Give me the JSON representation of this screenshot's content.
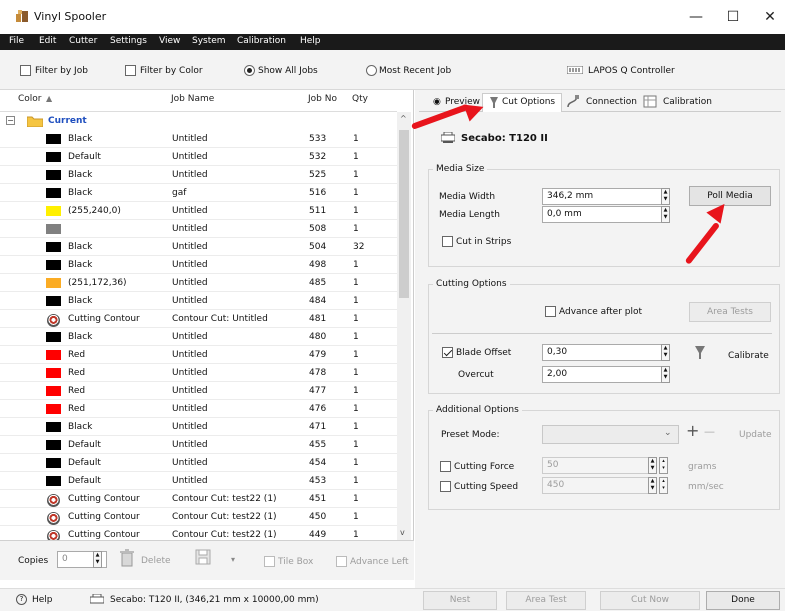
{
  "window": {
    "title": "Vinyl Spooler",
    "minimize": "—",
    "maximize": "☐",
    "close": "✕"
  },
  "menu": [
    "File",
    "Edit",
    "Cutter",
    "Settings",
    "View",
    "System",
    "Calibration",
    "Help"
  ],
  "toolbar": {
    "filter_by_job": "Filter by Job",
    "filter_by_color": "Filter by Color",
    "show_all_jobs": "Show All Jobs",
    "most_recent_job": "Most Recent Job",
    "controller": "LAPOS Q Controller"
  },
  "table": {
    "headers": {
      "color": "Color",
      "job_name": "Job Name",
      "job_no": "Job No",
      "qty": "Qty"
    },
    "group": "Current",
    "rows": [
      {
        "color": "Black",
        "swatch": "#000000",
        "job": "Untitled",
        "no": "533",
        "qty": "1"
      },
      {
        "color": "Default",
        "swatch": "#000000",
        "job": "Untitled",
        "no": "532",
        "qty": "1"
      },
      {
        "color": "Black",
        "swatch": "#000000",
        "job": "Untitled",
        "no": "525",
        "qty": "1"
      },
      {
        "color": "Black",
        "swatch": "#000000",
        "job": "gaf",
        "no": "516",
        "qty": "1"
      },
      {
        "color": "(255,240,0)",
        "swatch": "#fff000",
        "job": "Untitled",
        "no": "511",
        "qty": "1"
      },
      {
        "color": "",
        "swatch": "#808080",
        "job": "Untitled",
        "no": "508",
        "qty": "1"
      },
      {
        "color": "Black",
        "swatch": "#000000",
        "job": "Untitled",
        "no": "504",
        "qty": "32"
      },
      {
        "color": "Black",
        "swatch": "#000000",
        "job": "Untitled",
        "no": "498",
        "qty": "1"
      },
      {
        "color": "(251,172,36)",
        "swatch": "#fbac24",
        "job": "Untitled",
        "no": "485",
        "qty": "1"
      },
      {
        "color": "Black",
        "swatch": "#000000",
        "job": "Untitled",
        "no": "484",
        "qty": "1"
      },
      {
        "color": "Cutting Contour",
        "swatch": "contour",
        "job": "Contour Cut: Untitled",
        "no": "481",
        "qty": "1"
      },
      {
        "color": "Black",
        "swatch": "#000000",
        "job": "Untitled",
        "no": "480",
        "qty": "1"
      },
      {
        "color": "Red",
        "swatch": "#ff0000",
        "job": "Untitled",
        "no": "479",
        "qty": "1"
      },
      {
        "color": "Red",
        "swatch": "#ff0000",
        "job": "Untitled",
        "no": "478",
        "qty": "1"
      },
      {
        "color": "Red",
        "swatch": "#ff0000",
        "job": "Untitled",
        "no": "477",
        "qty": "1"
      },
      {
        "color": "Red",
        "swatch": "#ff0000",
        "job": "Untitled",
        "no": "476",
        "qty": "1"
      },
      {
        "color": "Black",
        "swatch": "#000000",
        "job": "Untitled",
        "no": "471",
        "qty": "1"
      },
      {
        "color": "Default",
        "swatch": "#000000",
        "job": "Untitled",
        "no": "455",
        "qty": "1"
      },
      {
        "color": "Default",
        "swatch": "#000000",
        "job": "Untitled",
        "no": "454",
        "qty": "1"
      },
      {
        "color": "Default",
        "swatch": "#000000",
        "job": "Untitled",
        "no": "453",
        "qty": "1"
      },
      {
        "color": "Cutting Contour",
        "swatch": "contour",
        "job": "Contour Cut: test22 (1)",
        "no": "451",
        "qty": "1"
      },
      {
        "color": "Cutting Contour",
        "swatch": "contour",
        "job": "Contour Cut: test22 (1)",
        "no": "450",
        "qty": "1"
      },
      {
        "color": "Cutting Contour",
        "swatch": "contour",
        "job": "Contour Cut: test22 (1)",
        "no": "449",
        "qty": "1"
      }
    ]
  },
  "bottom": {
    "copies_label": "Copies",
    "copies_value": "0",
    "delete": "Delete",
    "tile_box": "Tile Box",
    "advance_left": "Advance Left"
  },
  "tabs": [
    "Preview",
    "Cut Options",
    "Connection",
    "Calibration"
  ],
  "cutter_name": "Secabo: T120 II",
  "media_size": {
    "title": "Media Size",
    "width_label": "Media Width",
    "width_value": "346,2 mm",
    "length_label": "Media Length",
    "length_value": "0,0 mm",
    "poll_media": "Poll Media",
    "cut_in_strips": "Cut in Strips"
  },
  "cutting_options": {
    "title": "Cutting Options",
    "advance_after_plot": "Advance after plot",
    "area_tests": "Area Tests",
    "blade_offset_label": "Blade Offset",
    "blade_offset_value": "0,30",
    "overcut_label": "Overcut",
    "overcut_value": "2,00",
    "calibrate": "Calibrate"
  },
  "additional_options": {
    "title": "Additional Options",
    "preset_mode": "Preset Mode:",
    "plus": "+",
    "minus": "—",
    "update": "Update",
    "cutting_force_label": "Cutting Force",
    "cutting_force_value": "50",
    "cutting_force_unit": "grams",
    "cutting_speed_label": "Cutting Speed",
    "cutting_speed_value": "450",
    "cutting_speed_unit": "mm/sec"
  },
  "status": {
    "help": "Help",
    "device": "Secabo: T120 II,  (346,21 mm x 10000,00 mm)"
  },
  "actions": {
    "nest": "Nest",
    "area_test": "Area Test",
    "cut_now": "Cut Now",
    "done": "Done"
  },
  "colors": {
    "annotation_arrow": "#e8141c",
    "menubar": "#1a1a1a",
    "group_folder": "#f5c542",
    "current_group_text": "#1f4fbf"
  }
}
